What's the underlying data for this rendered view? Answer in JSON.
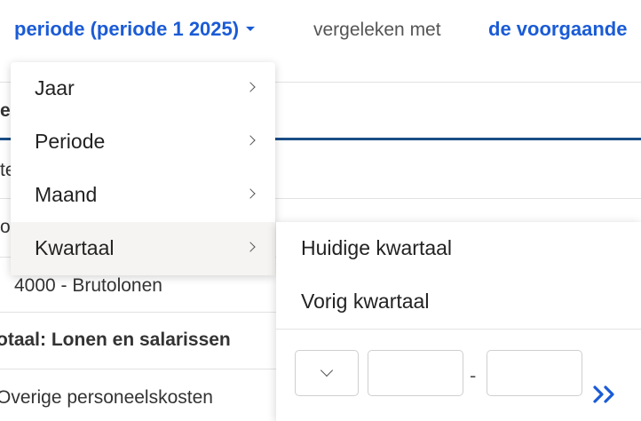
{
  "header": {
    "period_label": "periode (periode 1 2025)",
    "compare_text": "vergeleken met",
    "compare_link": "de voorgaande"
  },
  "report": {
    "rows": [
      {
        "text": "e",
        "bold": true
      },
      {
        "text": "te",
        "bold": false
      },
      {
        "text": "o",
        "bold": false
      },
      {
        "text": "4000 - Brutolonen",
        "bold": false
      },
      {
        "text": "otaal: Lonen en salarissen",
        "bold": true
      },
      {
        "text": "Overige personeelskosten",
        "bold": false
      }
    ]
  },
  "menu": {
    "items": [
      {
        "label": "Jaar"
      },
      {
        "label": "Periode"
      },
      {
        "label": "Maand"
      },
      {
        "label": "Kwartaal"
      }
    ],
    "active": "Kwartaal"
  },
  "submenu": {
    "items": [
      {
        "label": "Huidige kwartaal"
      },
      {
        "label": "Vorig kwartaal"
      }
    ],
    "range_separator": "-",
    "select_value": "",
    "from_value": "",
    "to_value": ""
  },
  "colors": {
    "accent": "#1a5bd6",
    "rule": "#1b4d86",
    "menu_active_bg": "#f6f4f2"
  }
}
